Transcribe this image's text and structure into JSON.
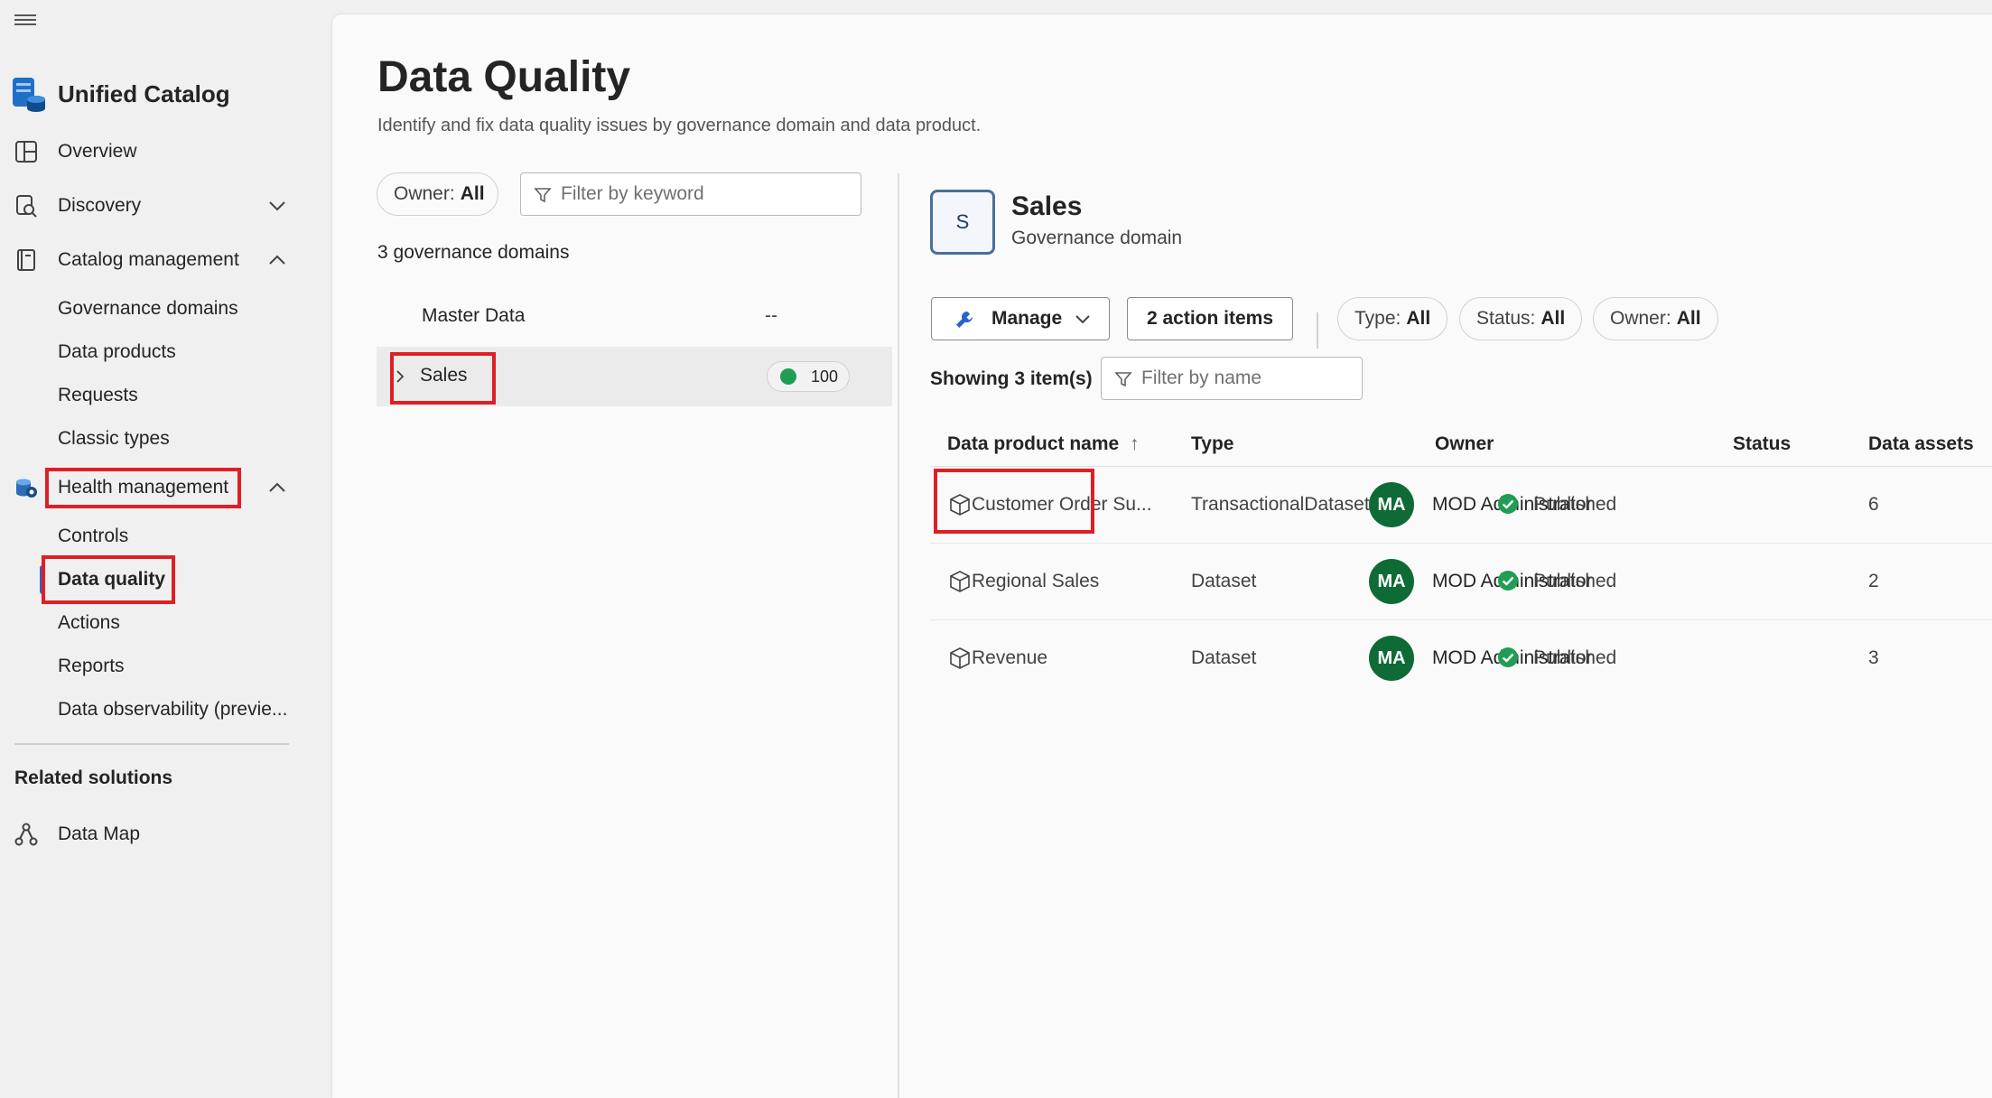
{
  "sidebar": {
    "app_title": "Unified Catalog",
    "nav": {
      "overview": "Overview",
      "discovery": "Discovery",
      "catalog_management": "Catalog management",
      "health_management": "Health management"
    },
    "catalog_sub": [
      "Governance domains",
      "Data products",
      "Requests",
      "Classic types"
    ],
    "health_sub": [
      "Controls",
      "Data quality",
      "Actions",
      "Reports",
      "Data observability (previe..."
    ],
    "related_heading": "Related solutions",
    "related": {
      "data_map": "Data Map"
    },
    "selected_item": "Data quality"
  },
  "page": {
    "title": "Data Quality",
    "subtitle": "Identify and fix data quality issues by governance domain and data product."
  },
  "left_panel": {
    "owner_label": "Owner:",
    "owner_value": "All",
    "keyword_placeholder": "Filter by keyword",
    "count_text": "3 governance domains",
    "domains": [
      {
        "name": "Master Data",
        "value": "--"
      },
      {
        "name": "Sales",
        "score": "100",
        "selected": true
      }
    ]
  },
  "detail": {
    "badge_letter": "S",
    "name": "Sales",
    "type": "Governance domain",
    "manage_label": "Manage",
    "action_items_label": "2 action items",
    "filters": {
      "type_label": "Type:",
      "type_value": "All",
      "status_label": "Status:",
      "status_value": "All",
      "owner_label": "Owner:",
      "owner_value": "All"
    },
    "showing_text": "Showing 3 item(s)",
    "name_filter_placeholder": "Filter by name",
    "columns": {
      "name": "Data product name",
      "sort_indicator": "↑",
      "type": "Type",
      "owner": "Owner",
      "status": "Status",
      "assets": "Data assets"
    },
    "rows": [
      {
        "name": "Customer Order Su...",
        "type": "TransactionalDataset",
        "owner_initials": "MA",
        "owner": "MOD Administrator",
        "status": "Published",
        "assets": "6"
      },
      {
        "name": "Regional Sales",
        "type": "Dataset",
        "owner_initials": "MA",
        "owner": "MOD Administrator",
        "status": "Published",
        "assets": "2"
      },
      {
        "name": "Revenue",
        "type": "Dataset",
        "owner_initials": "MA",
        "owner": "MOD Administrator",
        "status": "Published",
        "assets": "3"
      }
    ]
  },
  "colors": {
    "highlight_box": "#e01e25",
    "selected_indicator": "#2564cf",
    "avatar_bg": "#0e6b35",
    "published_green": "#1f9d55"
  }
}
